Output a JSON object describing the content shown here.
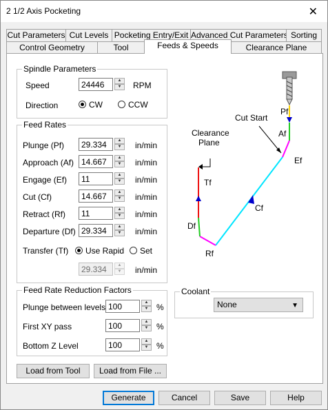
{
  "window": {
    "title": "2 1/2 Axis Pocketing",
    "close_glyph": "✕"
  },
  "tabs_top": [
    "Cut Parameters",
    "Cut Levels",
    "Pocketing Entry/Exit",
    "Advanced Cut Parameters",
    "Sorting"
  ],
  "tabs_bottom": [
    "Control Geometry",
    "Tool",
    "Feeds & Speeds",
    "Clearance Plane"
  ],
  "spindle": {
    "group_label": "Spindle Parameters",
    "speed_label": "Speed",
    "speed_value": "24446",
    "speed_unit": "RPM",
    "direction_label": "Direction",
    "cw_label": "CW",
    "ccw_label": "CCW"
  },
  "feed_rates": {
    "group_label": "Feed Rates",
    "unit": "in/min",
    "rows": [
      {
        "label": "Plunge (Pf)",
        "value": "29.334"
      },
      {
        "label": "Approach (Af)",
        "value": "14.667"
      },
      {
        "label": "Engage (Ef)",
        "value": "11"
      },
      {
        "label": "Cut (Cf)",
        "value": "14.667"
      },
      {
        "label": "Retract (Rf)",
        "value": "11"
      },
      {
        "label": "Departure  (Df)",
        "value": "29.334"
      }
    ],
    "transfer_label": "Transfer (Tf)",
    "use_rapid_label": "Use Rapid",
    "set_label": "Set",
    "transfer_value": "29.334"
  },
  "reduction": {
    "group_label": "Feed Rate Reduction Factors",
    "unit": "%",
    "rows": [
      {
        "label": "Plunge between levels",
        "value": "100"
      },
      {
        "label": "First XY pass",
        "value": "100"
      },
      {
        "label": "Bottom Z Level",
        "value": "100"
      }
    ]
  },
  "coolant": {
    "group_label": "Coolant",
    "value": "None"
  },
  "diagram": {
    "cut_start": "Cut Start",
    "clearance_line1": "Clearance",
    "clearance_line2": "Plane",
    "pf": "Pf",
    "af": "Af",
    "ef": "Ef",
    "cf": "Cf",
    "rf": "Rf",
    "df": "Df",
    "tf": "Tf"
  },
  "buttons": {
    "load_from_tool": "Load from Tool",
    "load_from_file": "Load from File ...",
    "generate": "Generate",
    "cancel": "Cancel",
    "save": "Save",
    "help": "Help"
  }
}
